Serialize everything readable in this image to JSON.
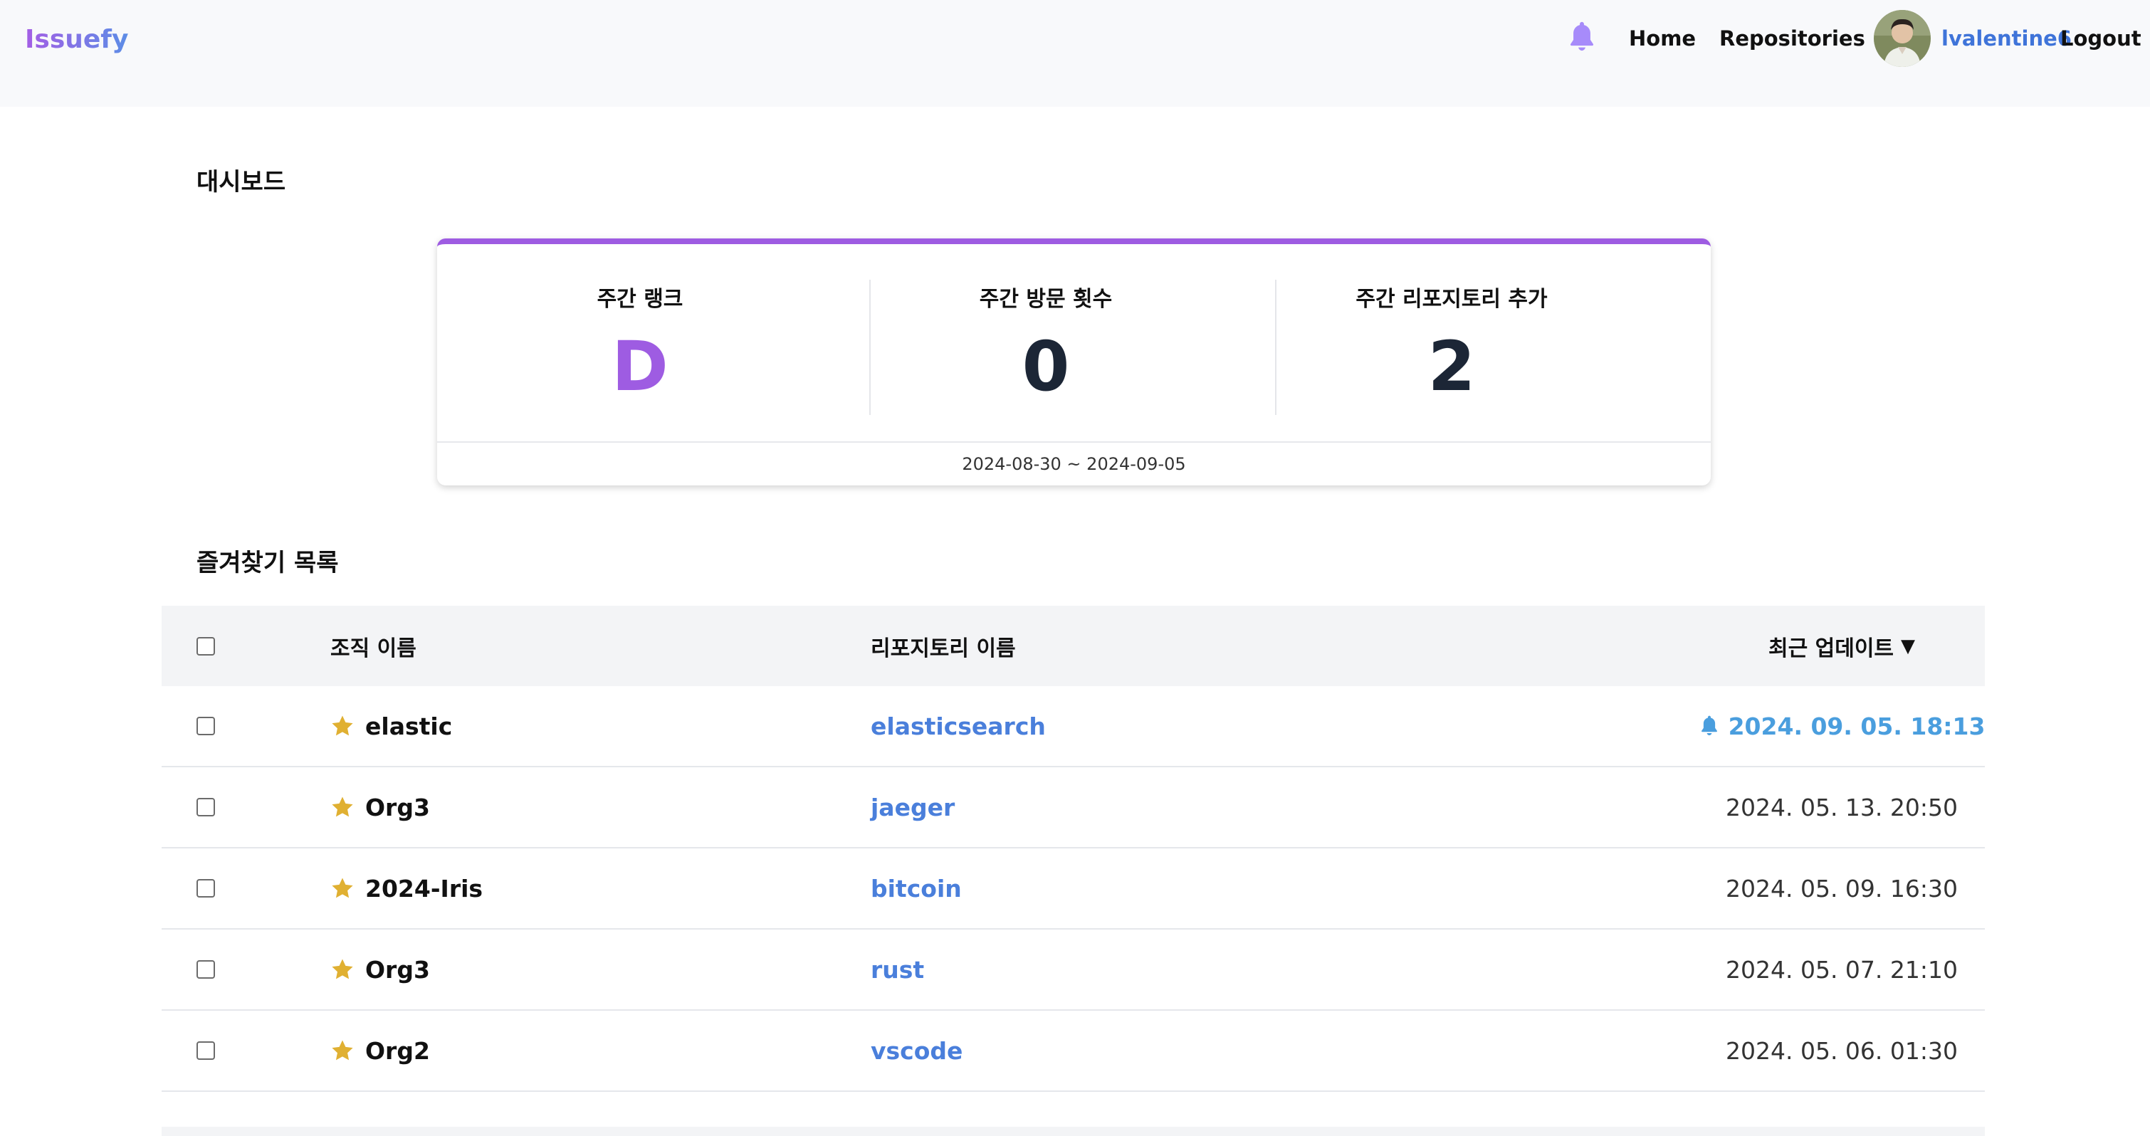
{
  "header": {
    "logo": "Issuefy",
    "nav": {
      "home": "Home",
      "repositories": "Repositories"
    },
    "user": {
      "username": "lvalentine6",
      "logout": "Logout"
    }
  },
  "dashboard": {
    "title": "대시보드",
    "stats": [
      {
        "label": "주간 랭크",
        "value": "D"
      },
      {
        "label": "주간 방문 횟수",
        "value": "0"
      },
      {
        "label": "주간 리포지토리 추가",
        "value": "2"
      }
    ],
    "date_range": "2024-08-30 ~ 2024-09-05"
  },
  "favorites": {
    "title": "즐겨찾기 목록",
    "columns": {
      "org": "조직 이름",
      "repo": "리포지토리 이름",
      "updated": "최근 업데이트",
      "sort_indicator": "▼"
    },
    "rows": [
      {
        "org": "elastic",
        "repo": "elasticsearch",
        "updated": "2024. 09. 05. 18:13",
        "has_update": true
      },
      {
        "org": "Org3",
        "repo": "jaeger",
        "updated": "2024. 05. 13. 20:50",
        "has_update": false
      },
      {
        "org": "2024-Iris",
        "repo": "bitcoin",
        "updated": "2024. 05. 09. 16:30",
        "has_update": false
      },
      {
        "org": "Org3",
        "repo": "rust",
        "updated": "2024. 05. 07. 21:10",
        "has_update": false
      },
      {
        "org": "Org2",
        "repo": "vscode",
        "updated": "2024. 05. 06. 01:30",
        "has_update": false
      }
    ]
  },
  "colors": {
    "accent_purple": "#9e5ce2",
    "link_blue": "#4a7fdb",
    "update_blue": "#4a9ede",
    "star_gold": "#e0b032",
    "bell_purple": "#a78bfa"
  },
  "icons": {
    "nav_bell": "bell-icon",
    "row_bell": "bell-icon",
    "favorite": "star-icon"
  }
}
